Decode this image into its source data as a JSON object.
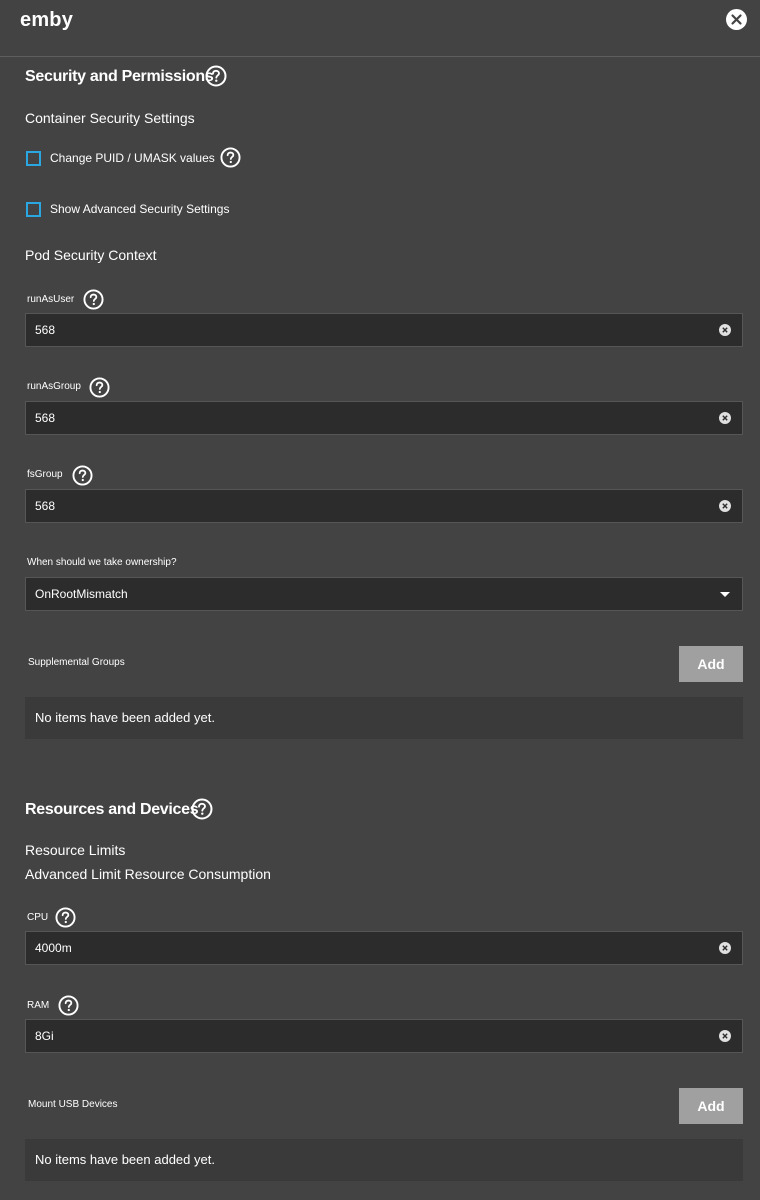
{
  "header": {
    "app_title": "emby",
    "close_icon": "close-circle-icon"
  },
  "security": {
    "title": "Security and Permissions",
    "container_settings": "Container Security Settings",
    "change_puid_label": "Change PUID / UMASK values",
    "show_advanced_label": "Show Advanced Security Settings",
    "pod_context": "Pod Security Context",
    "run_as_user": {
      "label": "runAsUser",
      "value": "568"
    },
    "run_as_group": {
      "label": "runAsGroup",
      "value": "568"
    },
    "fs_group": {
      "label": "fsGroup",
      "value": "568"
    },
    "ownership": {
      "label": "When should we take ownership?",
      "value": "OnRootMismatch"
    },
    "supplemental_groups": {
      "label": "Supplemental Groups",
      "add_label": "Add",
      "empty_text": "No items have been added yet."
    }
  },
  "resources": {
    "title": "Resources and Devices",
    "limits": "Resource Limits",
    "advanced_limit": "Advanced Limit Resource Consumption",
    "cpu": {
      "label": "CPU",
      "value": "4000m"
    },
    "ram": {
      "label": "RAM",
      "value": "8Gi"
    },
    "usb": {
      "label": "Mount USB Devices",
      "add_label": "Add",
      "empty_text": "No items have been added yet."
    }
  },
  "colors": {
    "background": "#434343",
    "input_bg": "#2c2c2c",
    "checkbox_accent": "#2aa7e0",
    "add_button": "#a0a0a0"
  }
}
